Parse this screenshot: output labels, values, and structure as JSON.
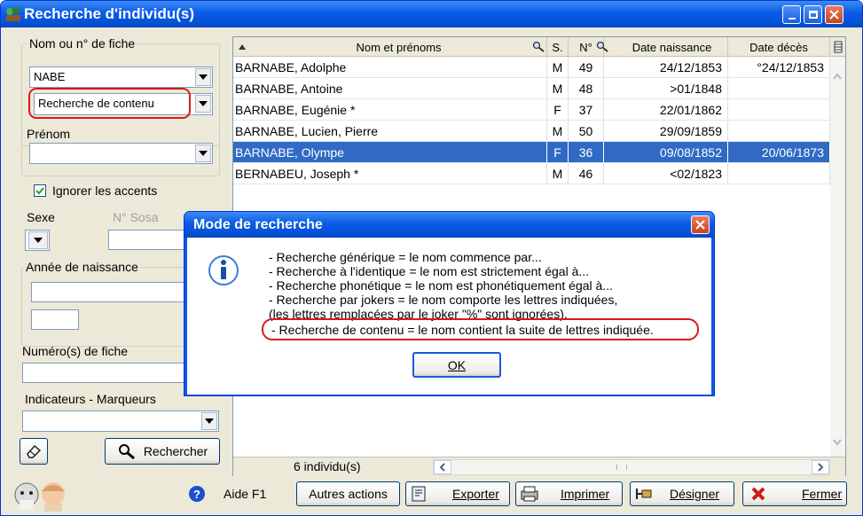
{
  "window": {
    "title": "Recherche d'individu(s)"
  },
  "left": {
    "group_name": "Nom ou n° de fiche",
    "name_value": "NABE",
    "search_mode": "Recherche de contenu",
    "group_prenom": "Prénom",
    "prenom_value": "",
    "ignore_accents": "Ignorer les accents",
    "sexe": "Sexe",
    "sosa": "N° Sosa",
    "group_annee": "Année de naissance",
    "numero_fiche": "Numéro(s) de fiche",
    "indicateurs": "Indicateurs - Marqueurs",
    "rechercher": "Rechercher"
  },
  "grid": {
    "headers": [
      "Nom et prénoms",
      "S.",
      "N°",
      "Date naissance",
      "Date décès"
    ],
    "rows": [
      {
        "nom": "BARNABE, Adolphe",
        "sexe": "M",
        "num": "49",
        "naissance": "24/12/1853",
        "deces": "°24/12/1853"
      },
      {
        "nom": "BARNABE, Antoine",
        "sexe": "M",
        "num": "48",
        "naissance": ">01/1848",
        "deces": ""
      },
      {
        "nom": "BARNABE, Eugénie  *",
        "sexe": "F",
        "num": "37",
        "naissance": "22/01/1862",
        "deces": ""
      },
      {
        "nom": "BARNABE, Lucien, Pierre",
        "sexe": "M",
        "num": "50",
        "naissance": "29/09/1859",
        "deces": ""
      },
      {
        "nom": "BARNABE, Olympe",
        "sexe": "F",
        "num": "36",
        "naissance": "09/08/1852",
        "deces": "20/06/1873"
      },
      {
        "nom": "BERNABEU, Joseph  *",
        "sexe": "M",
        "num": "46",
        "naissance": "<02/1823",
        "deces": ""
      }
    ],
    "selected_row": 4,
    "count": "6  individu(s)"
  },
  "bottom": {
    "aide": "Aide  F1",
    "autres": "Autres actions",
    "exporter": "Exporter",
    "imprimer": "Imprimer",
    "designer": "Désigner",
    "fermer": "Fermer"
  },
  "dialog": {
    "title": "Mode de recherche",
    "lines": [
      "- Recherche générique    = le nom commence par...",
      "- Recherche à l'identique = le nom est strictement égal à...",
      "- Recherche phonétique  = le nom est phonétiquement égal à...",
      "- Recherche par jokers   = le nom comporte les lettres indiquées,",
      "  (les lettres remplacées par le joker \"%\" sont ignorées).",
      "- Recherche de contenu = le nom contient la suite de lettres indiquée."
    ],
    "ok": "OK"
  },
  "colors": {
    "titlebar": "#0a5be6",
    "selection": "#316ac5",
    "annotation": "#d91919"
  }
}
